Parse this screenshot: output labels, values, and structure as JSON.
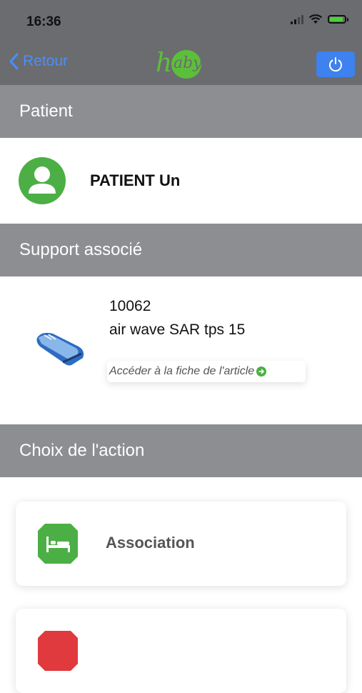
{
  "status_bar": {
    "time": "16:36",
    "battery_color": "#4cd139"
  },
  "nav": {
    "back_label": "Retour",
    "logo_text": "haby",
    "logo_color": "#5cbf3b",
    "accent": "#4a8ff7",
    "power_icon": "power-icon"
  },
  "patient_section": {
    "header": "Patient",
    "name": "PATIENT Un",
    "avatar_icon": "user-avatar-icon"
  },
  "support_section": {
    "header": "Support associé",
    "code": "10062",
    "name": "air wave SAR tps 15",
    "link_label": "Accéder à la fiche de l'article",
    "link_icon": "arrow-circle-icon"
  },
  "action_section": {
    "header": "Choix de l'action",
    "actions": [
      {
        "label": "Association",
        "icon": "bed-icon",
        "color": "#4caf45"
      },
      {
        "label": "",
        "icon": "action-icon",
        "color": "#e0393e"
      }
    ]
  }
}
